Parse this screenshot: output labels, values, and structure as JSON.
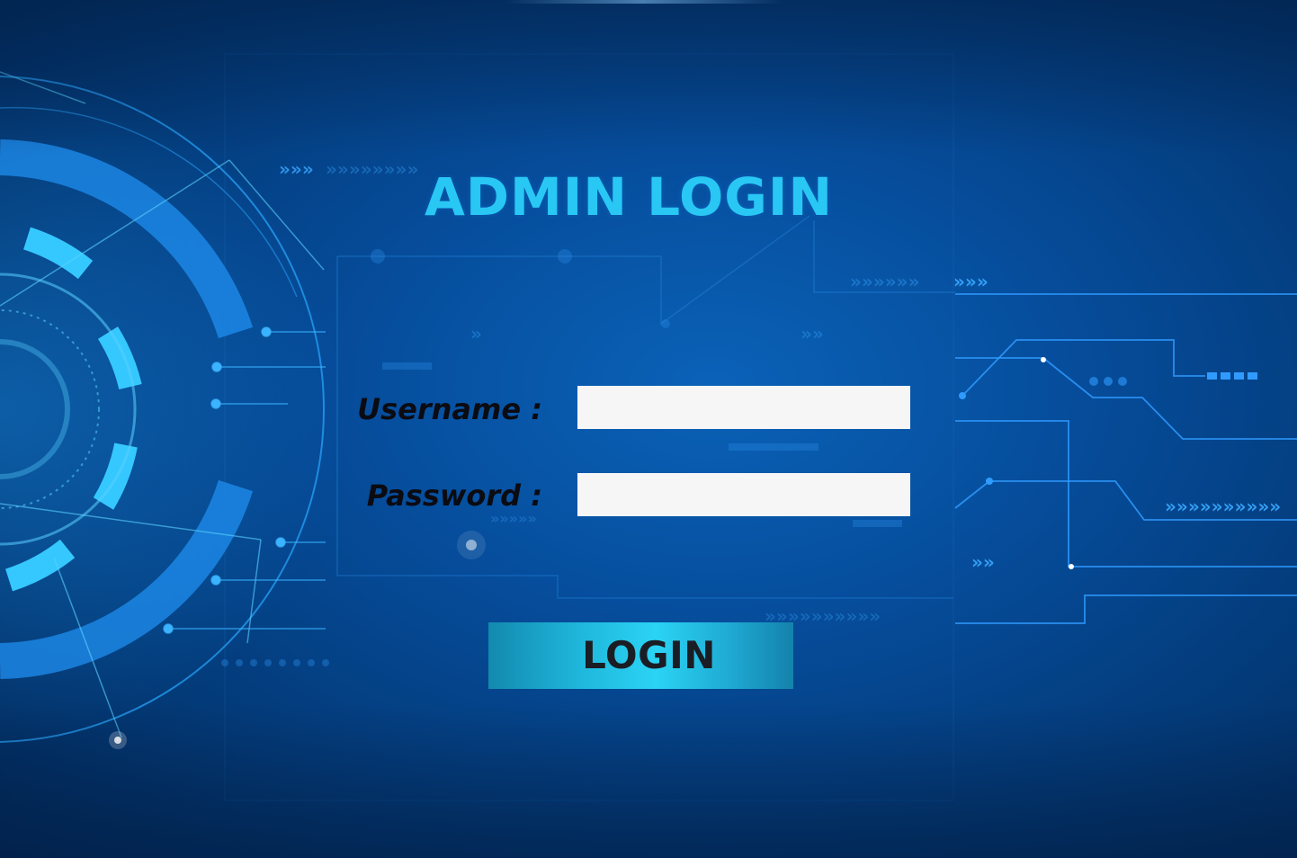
{
  "page": {
    "title": "ADMIN LOGIN"
  },
  "form": {
    "username_label": "Username :",
    "username_value": "",
    "password_label": "Password :",
    "password_value": "",
    "login_label": "LOGIN"
  },
  "colors": {
    "background": "#064d9c",
    "title": "#29c7f4",
    "label": "#0b0b12",
    "field": "#f6f6f6",
    "button_accent": "#2bd3f4",
    "button_text": "#1b1d24"
  },
  "decor": {
    "background_art": "circuit-technology-art"
  }
}
